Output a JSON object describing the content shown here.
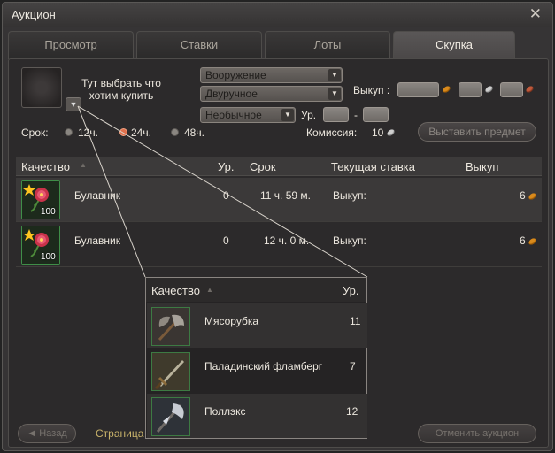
{
  "window": {
    "title": "Аукцион"
  },
  "tabs": [
    {
      "label": "Просмотр"
    },
    {
      "label": "Ставки"
    },
    {
      "label": "Лоты"
    },
    {
      "label": "Скупка"
    }
  ],
  "filters": {
    "hint": "Тут выбрать что хотим купить",
    "category": "Вооружение",
    "subcategory": "Двуручное",
    "rarity": "Необычное",
    "level_label": "Ур.",
    "level_separator": "-",
    "buyout_label": "Выкуп :"
  },
  "duration": {
    "label": "Срок:",
    "options": [
      "12ч.",
      "24ч.",
      "48ч."
    ],
    "selected": "24ч."
  },
  "commission": {
    "label": "Комиссия:",
    "value": "10"
  },
  "buttons": {
    "place_item": "Выставить предмет",
    "back": "◄ Назад",
    "cancel_auction": "Отменить аукцион"
  },
  "table": {
    "columns": [
      "Качество",
      "Ур.",
      "Срок",
      "Текущая ставка",
      "Выкуп"
    ],
    "rows": [
      {
        "name": "Булавник",
        "qty": "100",
        "level": "0",
        "time": "11 ч. 59 м.",
        "bid": "Выкуп:",
        "buyout": "6"
      },
      {
        "name": "Булавник",
        "qty": "100",
        "level": "0",
        "time": "12 ч. 0 м.",
        "bid": "Выкуп:",
        "buyout": "6"
      }
    ]
  },
  "pagination": {
    "label": "Страница"
  },
  "tooltip": {
    "columns": [
      "Качество",
      "Ур."
    ],
    "items": [
      {
        "name": "Мясорубка",
        "level": "11"
      },
      {
        "name": "Паладинский фламберг",
        "level": "7"
      },
      {
        "name": "Поллэкс",
        "level": "12"
      }
    ]
  },
  "colors": {
    "accent": "#e0704c",
    "gold": "#d98a1c",
    "silver": "#cfcfcf",
    "copper": "#c05a3c",
    "item_border": "#3f8e48"
  }
}
